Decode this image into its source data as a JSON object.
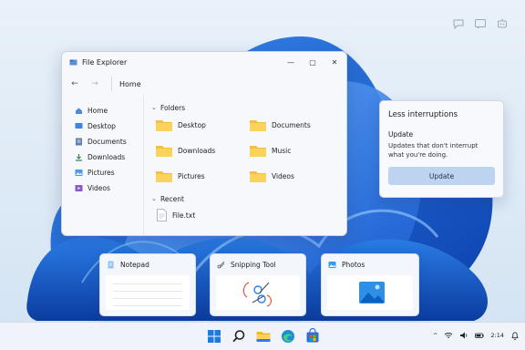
{
  "explorer": {
    "title": "File Explorer",
    "controls": {
      "minimize": "—",
      "maximize": "▢",
      "close": "✕"
    },
    "nav": {
      "back": "←",
      "forward": "→",
      "path": "Home"
    },
    "sidebar": [
      {
        "label": "Home",
        "icon": "home-icon"
      },
      {
        "label": "Desktop",
        "icon": "desktop-icon"
      },
      {
        "label": "Documents",
        "icon": "documents-icon"
      },
      {
        "label": "Downloads",
        "icon": "downloads-icon"
      },
      {
        "label": "Pictures",
        "icon": "pictures-icon"
      },
      {
        "label": "Videos",
        "icon": "videos-icon"
      }
    ],
    "folders_heading": "Folders",
    "folders": [
      "Desktop",
      "Documents",
      "Downloads",
      "Music",
      "Pictures",
      "Videos"
    ],
    "recent_heading": "Recent",
    "recent": [
      "File.txt"
    ]
  },
  "notification": {
    "heading": "Less interruptions",
    "title": "Update",
    "body": "Updates that don't interrupt what you're doing.",
    "button": "Update"
  },
  "task_view": [
    {
      "label": "Notepad",
      "icon": "notepad-icon"
    },
    {
      "label": "Snipping Tool",
      "icon": "snipping-tool-icon"
    },
    {
      "label": "Photos",
      "icon": "photos-icon"
    }
  ],
  "taskbar": {
    "apps": [
      "windows-start-icon",
      "search-icon",
      "file-explorer-icon",
      "edge-icon",
      "store-icon"
    ],
    "tray_glyphs": {
      "chevron": "^",
      "time": "2:14"
    }
  },
  "colors": {
    "accent": "#0a5bd3",
    "folder": "#f7c948",
    "button": "#bcd4ef"
  }
}
